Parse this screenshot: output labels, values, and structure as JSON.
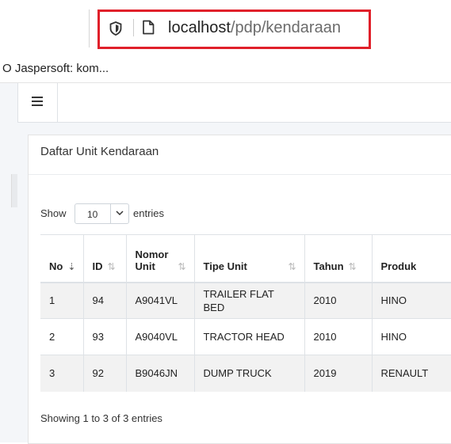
{
  "browser": {
    "url_host": "localhost",
    "url_path": "/pdp/kendaraan",
    "bookmark_label": "O Jaspersoft: kom..."
  },
  "card": {
    "title": "Daftar Unit Kendaraan"
  },
  "length_menu": {
    "show_label": "Show",
    "value": "10",
    "entries_label": "entries"
  },
  "table": {
    "columns": [
      "No",
      "ID",
      "Nomor Unit",
      "Tipe Unit",
      "Tahun",
      "Produk"
    ],
    "rows": [
      [
        "1",
        "94",
        "A9041VL",
        "TRAILER FLAT BED",
        "2010",
        "HINO"
      ],
      [
        "2",
        "93",
        "A9040VL",
        "TRACTOR HEAD",
        "2010",
        "HINO"
      ],
      [
        "3",
        "92",
        "B9046JN",
        "DUMP TRUCK",
        "2019",
        "RENAULT"
      ]
    ]
  },
  "info_text": "Showing 1 to 3 of 3 entries",
  "colors": {
    "highlight": "#e0202a",
    "stripe": "#f2f2f2"
  },
  "icons": {
    "tracking": "shield-icon",
    "page": "page-icon",
    "menu": "hamburger-icon",
    "sort": "sort-icon",
    "dropdown": "chevron-down-icon"
  }
}
